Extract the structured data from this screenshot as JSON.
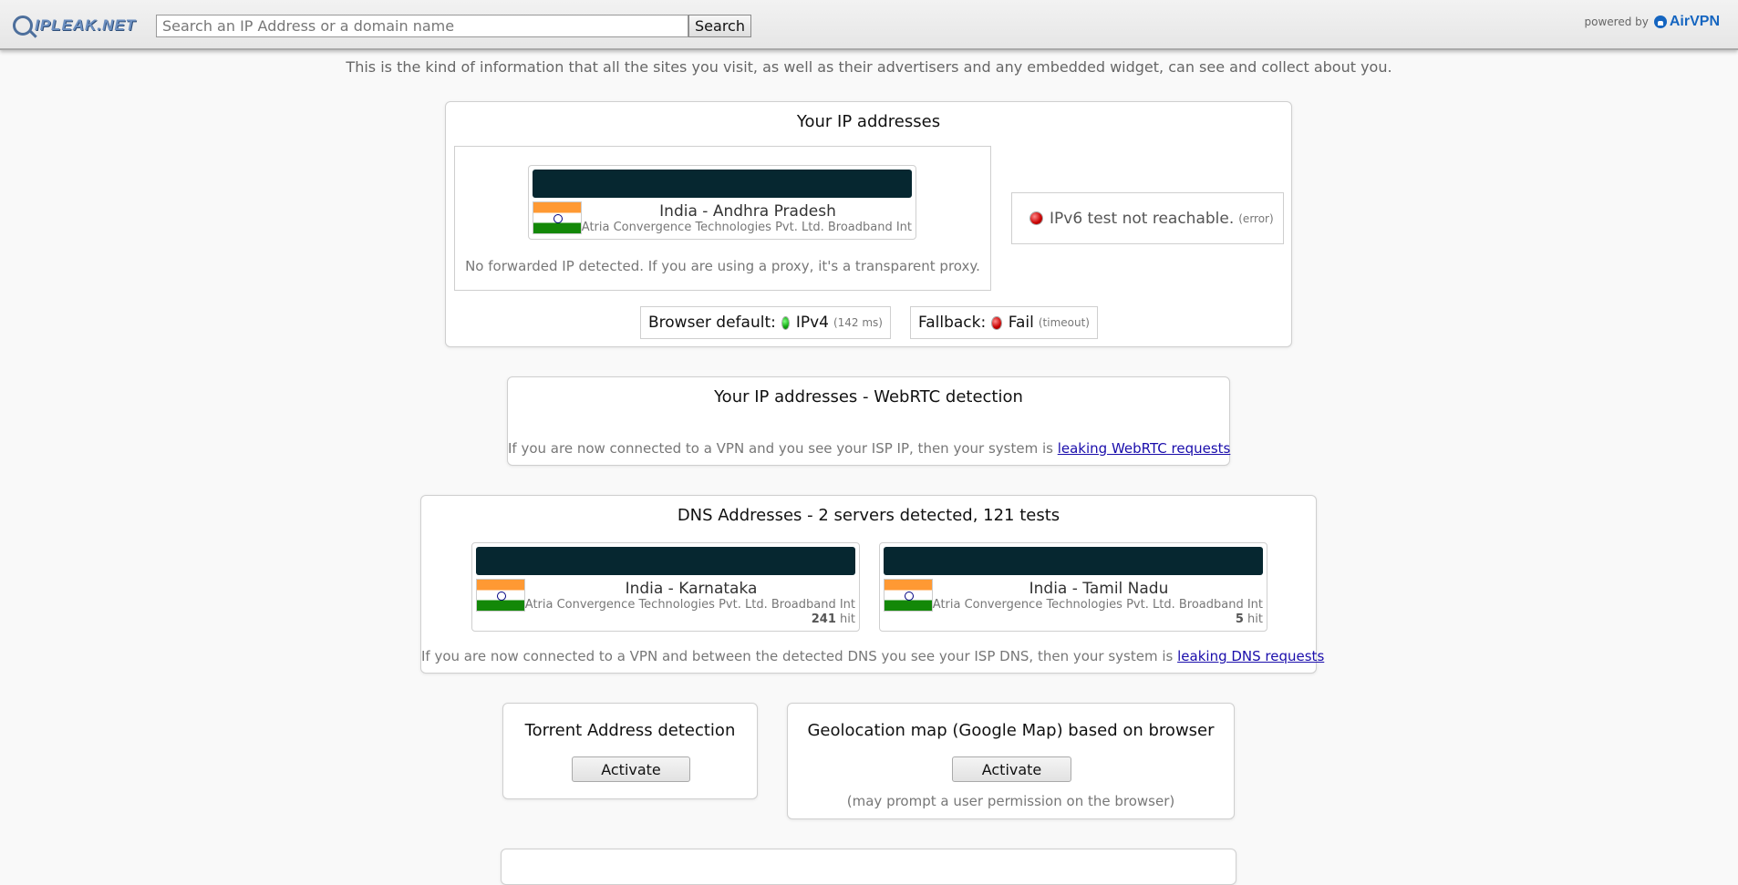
{
  "header": {
    "logo_text": "IPLEAK.NET",
    "search_placeholder": "Search an IP Address or a domain name",
    "search_button": "Search",
    "powered_by": "powered by",
    "brand": "AirVPN"
  },
  "intro": "This is the kind of information that all the sites you visit, as well as their advertisers and any embedded widget, can see and collect about you.",
  "ip_panel": {
    "title": "Your IP addresses",
    "ipv4": {
      "location": "India - Andhra Pradesh",
      "isp": "Atria Convergence Technologies Pvt. Ltd. Broadband Int"
    },
    "forwarded_note": "No forwarded IP detected. If you are using a proxy, it's a transparent proxy.",
    "ipv6": {
      "text": "IPv6 test not reachable.",
      "note": "(error)"
    },
    "browser_default": {
      "label": "Browser default:",
      "value": "IPv4",
      "note": "(142 ms)"
    },
    "fallback": {
      "label": "Fallback:",
      "value": "Fail",
      "note": "(timeout)"
    }
  },
  "webrtc_panel": {
    "title": "Your IP addresses - WebRTC detection",
    "note": "If you are now connected to a VPN and you see your ISP IP, then your system is",
    "link": "leaking WebRTC requests"
  },
  "dns_panel": {
    "title": "DNS Addresses - 2 servers detected, 121 tests",
    "servers": [
      {
        "location": "India - Karnataka",
        "isp": "Atria Convergence Technologies Pvt. Ltd. Broadband Int",
        "hits": "241",
        "hit_label": "hit"
      },
      {
        "location": "India - Tamil Nadu",
        "isp": "Atria Convergence Technologies Pvt. Ltd. Broadband Int",
        "hits": "5",
        "hit_label": "hit"
      }
    ],
    "note": "If you are now connected to a VPN and between the detected DNS you see your ISP DNS, then your system is",
    "link": "leaking DNS requests"
  },
  "torrent_panel": {
    "title": "Torrent Address detection",
    "button": "Activate"
  },
  "geo_panel": {
    "title": "Geolocation map (Google Map) based on browser",
    "button": "Activate",
    "note": "(may prompt a user permission on the browser)"
  },
  "colors": {
    "status_ok": "#12a812",
    "status_error": "#c80000",
    "link": "#1a0dab",
    "redacted": "#062730"
  }
}
